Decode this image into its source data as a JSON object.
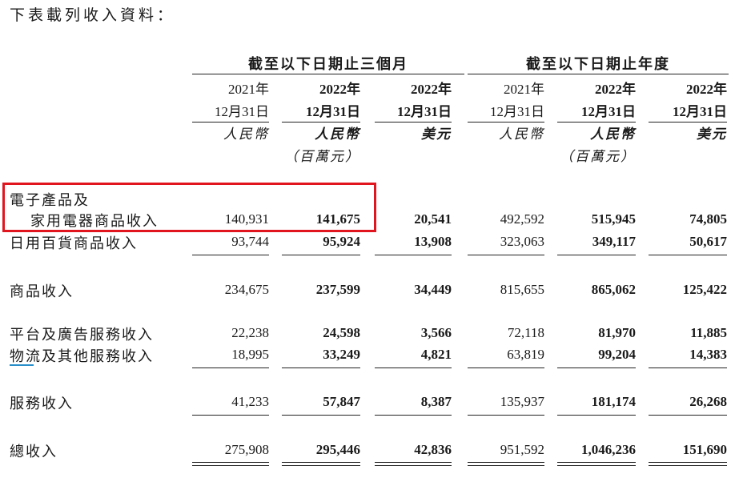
{
  "intro": "下表載列收入資料：",
  "groups": [
    {
      "label": "截至以下日期止三個月"
    },
    {
      "label": "截至以下日期止年度"
    }
  ],
  "columns": [
    {
      "year": "2021年",
      "date": "12月31日",
      "currency": "人民幣",
      "unit": "",
      "bold": false
    },
    {
      "year": "2022年",
      "date": "12月31日",
      "currency": "人民幣",
      "unit": "（百萬元）",
      "bold": true
    },
    {
      "year": "2022年",
      "date": "12月31日",
      "currency": "美元",
      "unit": "",
      "bold": true
    },
    {
      "year": "2021年",
      "date": "12月31日",
      "currency": "人民幣",
      "unit": "",
      "bold": false
    },
    {
      "year": "2022年",
      "date": "12月31日",
      "currency": "人民幣",
      "unit": "（百萬元）",
      "bold": true
    },
    {
      "year": "2022年",
      "date": "12月31日",
      "currency": "美元",
      "unit": "",
      "bold": true
    }
  ],
  "rows": [
    {
      "label": "電子產品及",
      "label2": "家用電器商品收入",
      "values": [
        "140,931",
        "141,675",
        "20,541",
        "492,592",
        "515,945",
        "74,805"
      ]
    },
    {
      "label": "日用百貨商品收入",
      "values": [
        "93,744",
        "95,924",
        "13,908",
        "323,063",
        "349,117",
        "50,617"
      ]
    },
    {
      "label": "商品收入",
      "values": [
        "234,675",
        "237,599",
        "34,449",
        "815,655",
        "865,062",
        "125,422"
      ]
    },
    {
      "label": "平台及廣告服務收入",
      "values": [
        "22,238",
        "24,598",
        "3,566",
        "72,118",
        "81,970",
        "11,885"
      ]
    },
    {
      "label": "物流及其他服務收入",
      "values": [
        "18,995",
        "33,249",
        "4,821",
        "63,819",
        "99,204",
        "14,383"
      ]
    },
    {
      "label": "服務收入",
      "values": [
        "41,233",
        "57,847",
        "8,387",
        "135,937",
        "181,174",
        "26,268"
      ]
    },
    {
      "label": "總收入",
      "values": [
        "275,908",
        "295,446",
        "42,836",
        "951,592",
        "1,046,236",
        "151,690"
      ]
    }
  ],
  "colors": {
    "highlight": "#e0151e",
    "underline_mark": "#2a8fc9"
  }
}
